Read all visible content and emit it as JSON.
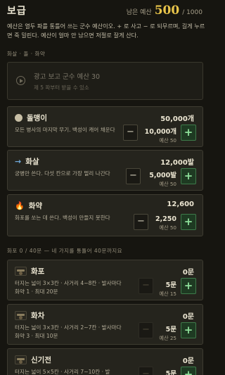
{
  "header": {
    "title": "보급",
    "budget_label": "남은 예산",
    "budget_value": "500",
    "budget_max": "/ 1000"
  },
  "description": "예산은 열두 파를 통틀어 쓰는 군수 예산이오. + 로 사고 − 로 되무르며, 길게 누르면 죽 밀린다. 예산이 얼마 안 남으면 저절로 잘게 산다.",
  "section_ammo": "화살 · 돌 · 화약",
  "ad": {
    "title": "광고 보고 군수 예산 30",
    "subtitle": "제 5 파부터 받을 수 있소"
  },
  "ammo_items": [
    {
      "name": "돌맹이",
      "icon": "stone-icon",
      "stock": "50,000개",
      "desc": "모든 병사의 마지막 무기. 백성이 캐어 채운다",
      "qty": "10,000개",
      "cost": "예산 50",
      "minus_active": true
    },
    {
      "name": "화살",
      "icon": "arrow-icon",
      "stock": "12,000발",
      "desc": "궁병만 쓴다. 다섯 칸으로 가장 멀리 나간다",
      "qty": "5,000발",
      "cost": "예산 50",
      "minus_active": true
    },
    {
      "name": "화약",
      "icon": "fire-icon",
      "stock": "12,600",
      "desc": "화포를 쏘는 데 쓴다. 백성이 만들지 못한다",
      "qty": "2,250",
      "cost": "예산 50",
      "minus_active": true
    }
  ],
  "section_artillery": "화포  0 / 40문 — 네 가지를 통틀어 40문까지요",
  "artillery_items": [
    {
      "name": "화포",
      "icon": "cannon-icon",
      "stock": "0문",
      "desc": "터지는 넓이 3×3칸 · 사거리 4~8칸 · 발사마다 화약 1 · 최대 20문",
      "qty": "5문",
      "cost": "예산 15",
      "minus_active": false
    },
    {
      "name": "화차",
      "icon": "hwacha-icon",
      "stock": "0문",
      "desc": "터지는 넓이 3×3칸 · 사거리 2~7칸 · 발사마다 화약 3 · 최대 10문",
      "qty": "5문",
      "cost": "예산 25",
      "minus_active": false
    },
    {
      "name": "신기전",
      "icon": "singijeon-icon",
      "stock": "0문",
      "desc": "터지는 넓이 5×5칸 · 사거리 7~10칸 · 발",
      "qty": "5문",
      "cost": "",
      "minus_active": false
    }
  ],
  "buttons": {
    "minus": "−",
    "plus": "+"
  },
  "colors": {
    "accent_gold": "#e8c44a",
    "plus_green": "#8ee09a",
    "card_bg": "#25241d"
  }
}
